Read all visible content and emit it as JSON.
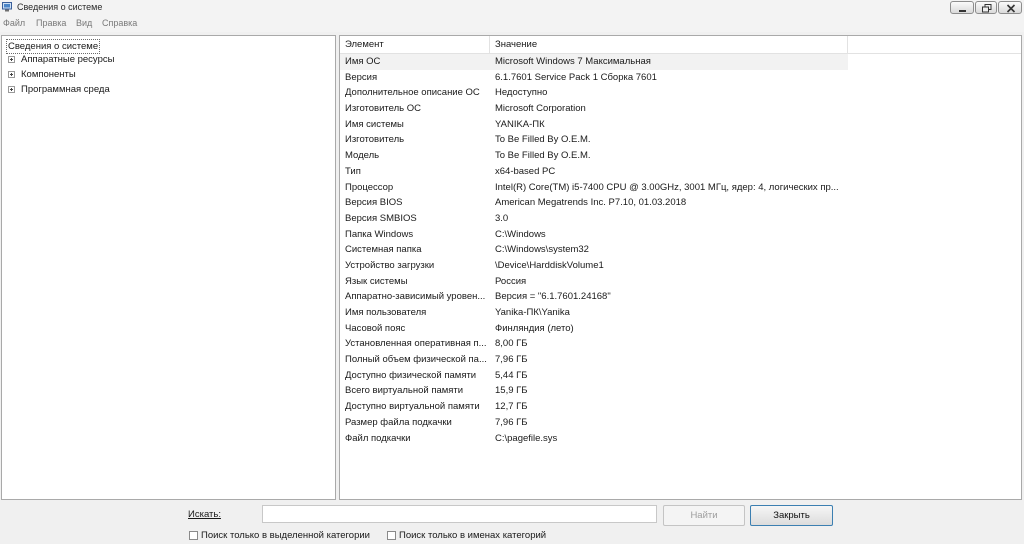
{
  "window": {
    "title": "Сведения о системе"
  },
  "menu": [
    "Файл",
    "Правка",
    "Вид",
    "Справка"
  ],
  "tree": {
    "root": "Сведения о системе",
    "nodes": [
      "Аппаратные ресурсы",
      "Компоненты",
      "Программная среда"
    ]
  },
  "table": {
    "columns": {
      "name": "Элемент",
      "value": "Значение"
    },
    "rows": [
      {
        "name": "Имя ОС",
        "value": "Microsoft Windows 7 Максимальная"
      },
      {
        "name": "Версия",
        "value": "6.1.7601 Service Pack 1 Сборка 7601"
      },
      {
        "name": "Дополнительное описание ОС",
        "value": "Недоступно"
      },
      {
        "name": "Изготовитель ОС",
        "value": "Microsoft Corporation"
      },
      {
        "name": "Имя системы",
        "value": "YANIKA-ПК"
      },
      {
        "name": "Изготовитель",
        "value": "To Be Filled By O.E.M."
      },
      {
        "name": "Модель",
        "value": "To Be Filled By O.E.M."
      },
      {
        "name": "Тип",
        "value": "x64-based PC"
      },
      {
        "name": "Процессор",
        "value": "Intel(R) Core(TM) i5-7400 CPU @ 3.00GHz, 3001 МГц, ядер: 4, логических пр..."
      },
      {
        "name": "Версия BIOS",
        "value": "American Megatrends Inc. P7.10, 01.03.2018"
      },
      {
        "name": "Версия SMBIOS",
        "value": "3.0"
      },
      {
        "name": "Папка Windows",
        "value": "C:\\Windows"
      },
      {
        "name": "Системная папка",
        "value": "C:\\Windows\\system32"
      },
      {
        "name": "Устройство загрузки",
        "value": "\\Device\\HarddiskVolume1"
      },
      {
        "name": "Язык системы",
        "value": "Россия"
      },
      {
        "name": "Аппаратно-зависимый уровен...",
        "value": "Версия = \"6.1.7601.24168\""
      },
      {
        "name": "Имя пользователя",
        "value": "Yanika-ПК\\Yanika"
      },
      {
        "name": "Часовой пояс",
        "value": "Финляндия (лето)"
      },
      {
        "name": "Установленная оперативная п...",
        "value": "8,00 ГБ"
      },
      {
        "name": "Полный объем физической па...",
        "value": "7,96 ГБ"
      },
      {
        "name": "Доступно физической памяти",
        "value": "5,44 ГБ"
      },
      {
        "name": "Всего виртуальной памяти",
        "value": "15,9 ГБ"
      },
      {
        "name": "Доступно виртуальной памяти",
        "value": "12,7 ГБ"
      },
      {
        "name": "Размер файла подкачки",
        "value": "7,96 ГБ"
      },
      {
        "name": "Файл подкачки",
        "value": "C:\\pagefile.sys"
      }
    ]
  },
  "search": {
    "label": "Искать:",
    "value": "",
    "find_button": "Найти",
    "close_button": "Закрыть",
    "option_selected_category": "Поиск только в выделенной категории",
    "option_category_names": "Поиск только в именах категорий"
  }
}
